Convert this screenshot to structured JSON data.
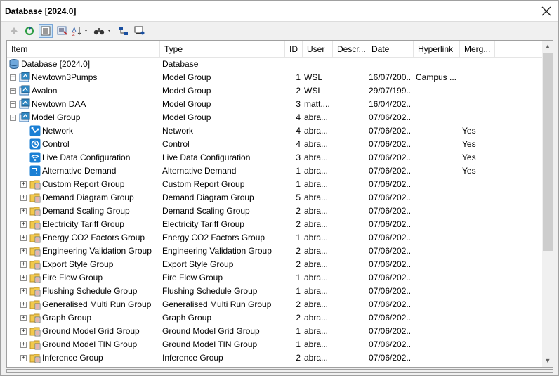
{
  "window": {
    "title": "Database [2024.0]"
  },
  "columns": {
    "item": "Item",
    "type": "Type",
    "id": "ID",
    "user": "User",
    "description": "Descr...",
    "date": "Date",
    "hyperlink": "Hyperlink",
    "merge": "Merg..."
  },
  "toolbar": {
    "buttons": [
      "up-arrow-icon",
      "refresh-icon",
      "tree-view-icon",
      "properties-icon",
      "sort-icon",
      "find-icon",
      "filter-icon",
      "network-icon"
    ]
  },
  "rows": [
    {
      "level": 0,
      "expander": "",
      "icon": "database",
      "item": "Database [2024.0]",
      "type": "Database",
      "id": "",
      "user": "",
      "date": "",
      "hyperlink": "",
      "merge": ""
    },
    {
      "level": 1,
      "expander": "+",
      "icon": "group",
      "item": "Newtown3Pumps",
      "type": "Model Group",
      "id": "1",
      "user": "WSL",
      "date": "16/07/200...",
      "hyperlink": "Campus ...",
      "merge": ""
    },
    {
      "level": 1,
      "expander": "+",
      "icon": "group",
      "item": "Avalon",
      "type": "Model Group",
      "id": "2",
      "user": "WSL",
      "date": "29/07/199...",
      "hyperlink": "",
      "merge": ""
    },
    {
      "level": 1,
      "expander": "+",
      "icon": "group",
      "item": "Newtown DAA",
      "type": "Model Group",
      "id": "3",
      "user": "matt....",
      "date": "16/04/202...",
      "hyperlink": "",
      "merge": ""
    },
    {
      "level": 1,
      "expander": "-",
      "icon": "group",
      "item": "Model Group",
      "type": "Model Group",
      "id": "4",
      "user": "abra...",
      "date": "07/06/202...",
      "hyperlink": "",
      "merge": ""
    },
    {
      "level": 2,
      "expander": "",
      "icon": "network",
      "item": "Network",
      "type": "Network",
      "id": "4",
      "user": "abra...",
      "date": "07/06/202...",
      "hyperlink": "",
      "merge": "Yes"
    },
    {
      "level": 2,
      "expander": "",
      "icon": "control",
      "item": "Control",
      "type": "Control",
      "id": "4",
      "user": "abra...",
      "date": "07/06/202...",
      "hyperlink": "",
      "merge": "Yes"
    },
    {
      "level": 2,
      "expander": "",
      "icon": "live",
      "item": "Live Data Configuration",
      "type": "Live Data Configuration",
      "id": "3",
      "user": "abra...",
      "date": "07/06/202...",
      "hyperlink": "",
      "merge": "Yes"
    },
    {
      "level": 2,
      "expander": "",
      "icon": "demand",
      "item": "Alternative Demand",
      "type": "Alternative Demand",
      "id": "1",
      "user": "abra...",
      "date": "07/06/202...",
      "hyperlink": "",
      "merge": "Yes"
    },
    {
      "level": 2,
      "expander": "+",
      "icon": "folder",
      "item": "Custom Report Group",
      "type": "Custom Report Group",
      "id": "1",
      "user": "abra...",
      "date": "07/06/202...",
      "hyperlink": "",
      "merge": ""
    },
    {
      "level": 2,
      "expander": "+",
      "icon": "folder",
      "item": "Demand Diagram Group",
      "type": "Demand Diagram Group",
      "id": "5",
      "user": "abra...",
      "date": "07/06/202...",
      "hyperlink": "",
      "merge": ""
    },
    {
      "level": 2,
      "expander": "+",
      "icon": "folder",
      "item": "Demand Scaling Group",
      "type": "Demand Scaling Group",
      "id": "2",
      "user": "abra...",
      "date": "07/06/202...",
      "hyperlink": "",
      "merge": ""
    },
    {
      "level": 2,
      "expander": "+",
      "icon": "folder",
      "item": "Electricity Tariff Group",
      "type": "Electricity Tariff Group",
      "id": "2",
      "user": "abra...",
      "date": "07/06/202...",
      "hyperlink": "",
      "merge": ""
    },
    {
      "level": 2,
      "expander": "+",
      "icon": "folder",
      "item": "Energy CO2 Factors Group",
      "type": "Energy CO2 Factors Group",
      "id": "1",
      "user": "abra...",
      "date": "07/06/202...",
      "hyperlink": "",
      "merge": ""
    },
    {
      "level": 2,
      "expander": "+",
      "icon": "folder",
      "item": "Engineering Validation Group",
      "type": "Engineering Validation Group",
      "id": "2",
      "user": "abra...",
      "date": "07/06/202...",
      "hyperlink": "",
      "merge": ""
    },
    {
      "level": 2,
      "expander": "+",
      "icon": "folder",
      "item": "Export Style Group",
      "type": "Export Style Group",
      "id": "2",
      "user": "abra...",
      "date": "07/06/202...",
      "hyperlink": "",
      "merge": ""
    },
    {
      "level": 2,
      "expander": "+",
      "icon": "folder",
      "item": "Fire Flow Group",
      "type": "Fire Flow Group",
      "id": "1",
      "user": "abra...",
      "date": "07/06/202...",
      "hyperlink": "",
      "merge": ""
    },
    {
      "level": 2,
      "expander": "+",
      "icon": "folder",
      "item": "Flushing Schedule Group",
      "type": "Flushing Schedule Group",
      "id": "1",
      "user": "abra...",
      "date": "07/06/202...",
      "hyperlink": "",
      "merge": ""
    },
    {
      "level": 2,
      "expander": "+",
      "icon": "folder",
      "item": "Generalised Multi Run Group",
      "type": "Generalised Multi Run Group",
      "id": "2",
      "user": "abra...",
      "date": "07/06/202...",
      "hyperlink": "",
      "merge": ""
    },
    {
      "level": 2,
      "expander": "+",
      "icon": "folder",
      "item": "Graph Group",
      "type": "Graph Group",
      "id": "2",
      "user": "abra...",
      "date": "07/06/202...",
      "hyperlink": "",
      "merge": ""
    },
    {
      "level": 2,
      "expander": "+",
      "icon": "folder",
      "item": "Ground Model Grid Group",
      "type": "Ground Model Grid Group",
      "id": "1",
      "user": "abra...",
      "date": "07/06/202...",
      "hyperlink": "",
      "merge": ""
    },
    {
      "level": 2,
      "expander": "+",
      "icon": "folder",
      "item": "Ground Model TIN Group",
      "type": "Ground Model TIN Group",
      "id": "1",
      "user": "abra...",
      "date": "07/06/202...",
      "hyperlink": "",
      "merge": ""
    },
    {
      "level": 2,
      "expander": "+",
      "icon": "folder",
      "item": "Inference Group",
      "type": "Inference Group",
      "id": "2",
      "user": "abra...",
      "date": "07/06/202...",
      "hyperlink": "",
      "merge": ""
    }
  ],
  "colors": {
    "network_icon": "#1a7fd4",
    "folder": "#f2c94c",
    "group_icon": "#2e86c1"
  }
}
